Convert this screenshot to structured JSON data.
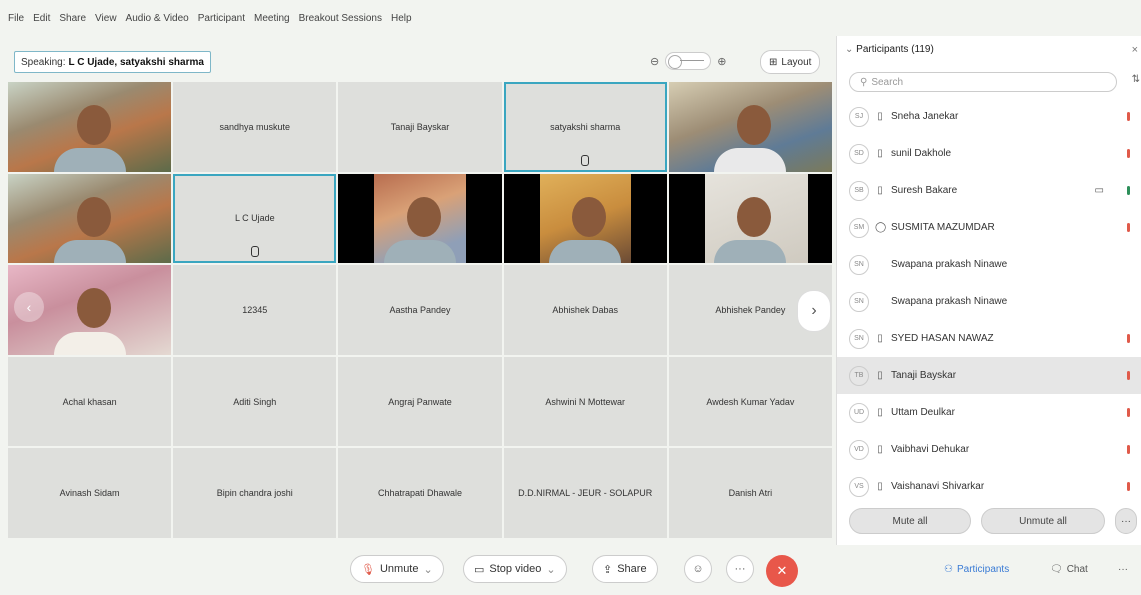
{
  "menu": [
    "File",
    "Edit",
    "Share",
    "View",
    "Audio & Video",
    "Participant",
    "Meeting",
    "Breakout Sessions",
    "Help"
  ],
  "toolbar": {
    "speaking_prefix": "Speaking:",
    "speaking_names": "L C Ujade, satyakshi sharma",
    "zoom_out": "⊖",
    "zoom_in": "⊕",
    "layout_label": "Layout"
  },
  "tiles": [
    {
      "name": "",
      "video": "v1"
    },
    {
      "name": "sandhya muskute",
      "video": ""
    },
    {
      "name": "Tanaji Bayskar",
      "video": ""
    },
    {
      "name": "satyakshi sharma",
      "video": "",
      "active": true,
      "mic": true
    },
    {
      "name": "",
      "video": "v2"
    },
    {
      "name": "",
      "video": "v1"
    },
    {
      "name": "L C Ujade",
      "video": "",
      "active": true,
      "mic": true
    },
    {
      "name": "",
      "video": "v3"
    },
    {
      "name": "",
      "video": "v4"
    },
    {
      "name": "",
      "video": "v6"
    },
    {
      "name": "",
      "video": "v7"
    },
    {
      "name": "12345",
      "video": ""
    },
    {
      "name": "Aastha Pandey",
      "video": ""
    },
    {
      "name": "Abhishek Dabas",
      "video": ""
    },
    {
      "name": "Abhishek Pandey",
      "video": ""
    },
    {
      "name": "Achal khasan",
      "video": ""
    },
    {
      "name": "Aditi Singh",
      "video": ""
    },
    {
      "name": "Angraj Panwate",
      "video": ""
    },
    {
      "name": "Ashwini N Mottewar",
      "video": ""
    },
    {
      "name": "Awdesh Kumar Yadav",
      "video": ""
    },
    {
      "name": "Avinash Sidam",
      "video": ""
    },
    {
      "name": "Bipin chandra joshi",
      "video": ""
    },
    {
      "name": "Chhatrapati Dhawale",
      "video": ""
    },
    {
      "name": "D.D.NIRMAL - JEUR - SOLAPUR",
      "video": ""
    },
    {
      "name": "Danish Atri",
      "video": ""
    }
  ],
  "bottom": {
    "unmute": "Unmute",
    "stop_video": "Stop video",
    "share": "Share",
    "participants": "Participants",
    "chat": "Chat"
  },
  "panel": {
    "title": "Participants (119)",
    "search_placeholder": "Search",
    "participants": [
      {
        "initials": "SJ",
        "name": "Sneha Janekar",
        "device": "phone",
        "mic": "muted"
      },
      {
        "initials": "SD",
        "name": "sunil Dakhole",
        "device": "phone",
        "mic": "muted"
      },
      {
        "initials": "SB",
        "name": "Suresh Bakare",
        "device": "phone",
        "mic": "active",
        "camera": true
      },
      {
        "initials": "SM",
        "name": "SUSMITA MAZUMDAR",
        "device": "web",
        "mic": "muted"
      },
      {
        "initials": "SN",
        "name": "Swapana prakash Ninawe",
        "device": "",
        "mic": ""
      },
      {
        "initials": "SN",
        "name": "Swapana prakash Ninawe",
        "device": "",
        "mic": ""
      },
      {
        "initials": "SN",
        "name": "SYED HASAN NAWAZ",
        "device": "phone",
        "mic": "muted"
      },
      {
        "initials": "TB",
        "name": "Tanaji Bayskar",
        "device": "phone",
        "mic": "muted",
        "selected": true
      },
      {
        "initials": "UD",
        "name": "Uttam Deulkar",
        "device": "phone",
        "mic": "muted"
      },
      {
        "initials": "VD",
        "name": "Vaibhavi Dehukar",
        "device": "phone",
        "mic": "muted"
      },
      {
        "initials": "VS",
        "name": "Vaishanavi Shivarkar",
        "device": "phone",
        "mic": "muted"
      }
    ],
    "mute_all": "Mute all",
    "unmute_all": "Unmute all"
  },
  "colors": {
    "accent": "#3aa6c0",
    "end_call": "#e8574a",
    "mic_muted": "#e05a4a",
    "mic_active": "#2d8f5a"
  }
}
